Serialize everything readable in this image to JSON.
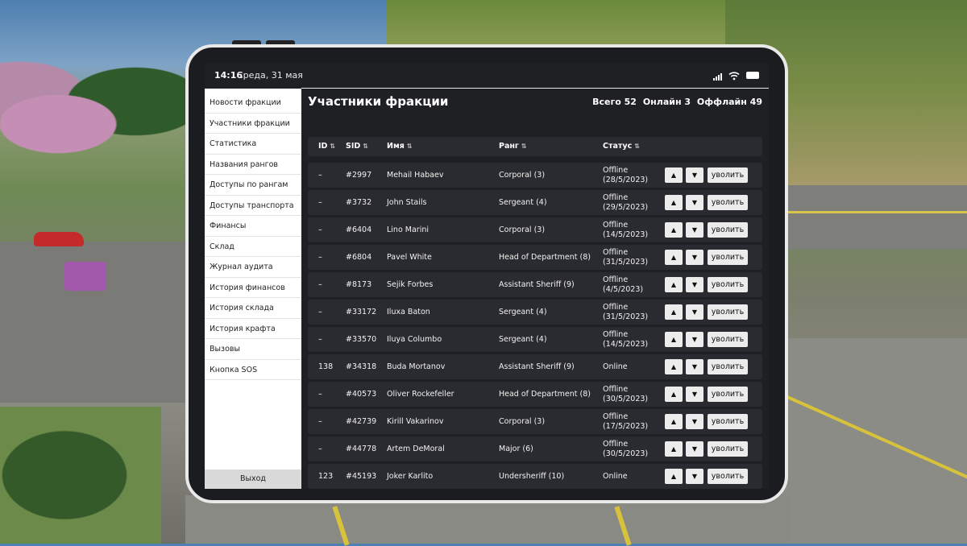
{
  "status_bar": {
    "time": "14:16",
    "date": "Среда, 31 мая"
  },
  "sidebar": {
    "items": [
      {
        "label": "Новости фракции"
      },
      {
        "label": "Участники фракции"
      },
      {
        "label": "Статистика"
      },
      {
        "label": "Названия рангов"
      },
      {
        "label": "Доступы по рангам"
      },
      {
        "label": "Доступы транспорта"
      },
      {
        "label": "Финансы"
      },
      {
        "label": "Склад"
      },
      {
        "label": "Журнал аудита"
      },
      {
        "label": "История финансов"
      },
      {
        "label": "История склада"
      },
      {
        "label": "История крафта"
      },
      {
        "label": "Вызовы"
      },
      {
        "label": "Кнопка SOS"
      }
    ],
    "exit_label": "Выход"
  },
  "main": {
    "title": "Участники фракции",
    "totals": {
      "total": "Всего 52",
      "online": "Онлайн 3",
      "offline": "Оффлайн 49"
    },
    "columns": {
      "id": "ID",
      "sid": "SID",
      "name": "Имя",
      "rank": "Ранг",
      "status": "Статус"
    },
    "up_icon": "▲",
    "down_icon": "▼",
    "fire_label": "уволить",
    "rows": [
      {
        "id": "–",
        "sid": "#2997",
        "name": "Mehail Habaev",
        "rank": "Corporal (3)",
        "status": "Offline",
        "status_date": "(28/5/2023)"
      },
      {
        "id": "–",
        "sid": "#3732",
        "name": "John Stails",
        "rank": "Sergeant (4)",
        "status": "Offline",
        "status_date": "(29/5/2023)"
      },
      {
        "id": "–",
        "sid": "#6404",
        "name": "Lino Marini",
        "rank": "Corporal (3)",
        "status": "Offline",
        "status_date": "(14/5/2023)"
      },
      {
        "id": "–",
        "sid": "#6804",
        "name": "Pavel White",
        "rank": "Head of Department (8)",
        "status": "Offline",
        "status_date": "(31/5/2023)"
      },
      {
        "id": "–",
        "sid": "#8173",
        "name": "Sejik Forbes",
        "rank": "Assistant Sheriff (9)",
        "status": "Offline",
        "status_date": "(4/5/2023)"
      },
      {
        "id": "–",
        "sid": "#33172",
        "name": "Iluxa Baton",
        "rank": "Sergeant (4)",
        "status": "Offline",
        "status_date": "(31/5/2023)"
      },
      {
        "id": "–",
        "sid": "#33570",
        "name": "Iluya Columbo",
        "rank": "Sergeant (4)",
        "status": "Offline",
        "status_date": "(14/5/2023)"
      },
      {
        "id": "138",
        "sid": "#34318",
        "name": "Buda Mortanov",
        "rank": "Assistant Sheriff (9)",
        "status": "Online",
        "status_date": ""
      },
      {
        "id": "–",
        "sid": "#40573",
        "name": "Oliver Rockefeller",
        "rank": "Head of Department (8)",
        "status": "Offline",
        "status_date": "(30/5/2023)"
      },
      {
        "id": "–",
        "sid": "#42739",
        "name": "Kirill Vakarinov",
        "rank": "Corporal (3)",
        "status": "Offline",
        "status_date": "(17/5/2023)"
      },
      {
        "id": "–",
        "sid": "#44778",
        "name": "Artem DeMoral",
        "rank": "Major (6)",
        "status": "Offline",
        "status_date": "(30/5/2023)"
      },
      {
        "id": "123",
        "sid": "#45193",
        "name": "Joker Karlito",
        "rank": "Undersheriff (10)",
        "status": "Online",
        "status_date": ""
      }
    ]
  }
}
